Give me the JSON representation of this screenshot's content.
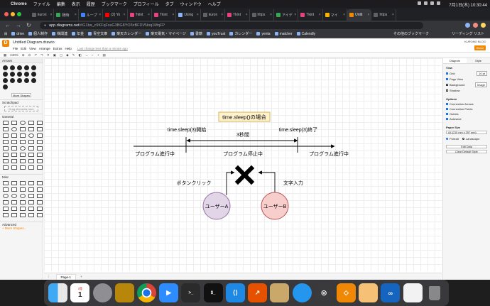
{
  "menubar": {
    "app": "Chrome",
    "items": [
      "ファイル",
      "編集",
      "表示",
      "履歴",
      "ブックマーク",
      "プロフィール",
      "タブ",
      "ウィンドウ",
      "ヘルプ"
    ],
    "clock": "7月1日(木) 10:30:44"
  },
  "tabs": [
    {
      "label": "kuron",
      "color": "#5f6368"
    },
    {
      "label": "随時",
      "color": "#34a853"
    },
    {
      "label": "ループ",
      "color": "#4285f4"
    },
    {
      "label": "(2) Yo",
      "color": "#ff0000"
    },
    {
      "label": "Tkint",
      "color": "#e8437a"
    },
    {
      "label": "Tkint",
      "color": "#e8437a"
    },
    {
      "label": "Using",
      "color": "#8ab4f8"
    },
    {
      "label": "kuron",
      "color": "#5f6368"
    },
    {
      "label": "Tkint",
      "color": "#e8437a"
    },
    {
      "label": "https",
      "color": "#5f6368"
    },
    {
      "label": "アイデ",
      "color": "#34a853"
    },
    {
      "label": "Tkint",
      "color": "#e8437a"
    },
    {
      "label": "マイ",
      "color": "#f4b400"
    },
    {
      "label": "Untit",
      "color": "#f08705"
    },
    {
      "label": "https",
      "color": "#5f6368"
    }
  ],
  "address": {
    "host": "app.diagrams.net",
    "path": "/#G1ba_c9KFqFssG3BG8YO3xBFDVNoq1MqFP"
  },
  "bookmarks": [
    "drive",
    "個人制作",
    "株関連",
    "年金",
    "青空文庫",
    "楽天カレンダー",
    "楽天電気・マイページ",
    "書籍",
    "youTrust",
    "カレンダー",
    "yenta",
    "matcher",
    "Calendly"
  ],
  "bookmarks_right": [
    "その他のブックマーク",
    "リーディング リスト"
  ],
  "drawio": {
    "logo": "D",
    "title": "Untitled Diagram.drawio",
    "menus": [
      "File",
      "Edit",
      "View",
      "Arrange",
      "Extras",
      "Help"
    ],
    "unsaved": "Last change less than a minute ago",
    "user": "KURONO BLOG",
    "share": "Share",
    "zoom": "240%",
    "sidebar": {
      "search_section": "Arrows",
      "more_shapes": "More Shapes",
      "scratchpad": "Scratchpad",
      "drop_here": "Drag elements here",
      "general": "General",
      "misc": "Misc",
      "advanced": "Advanced",
      "more_shapes_link": "+ More Shapes..."
    },
    "page_tab": "Page-1",
    "format": {
      "tab_diagram": "Diagram",
      "tab_style": "Style",
      "view": "View",
      "grid": "Grid",
      "grid_size": "10 pt",
      "page_view": "Page View",
      "background": "Background",
      "image": "Image",
      "shadow": "Shadow",
      "options": "Options",
      "connection_arrows": "Connection Arrows",
      "connection_points": "Connection Points",
      "guides": "Guides",
      "autosave": "Autosave",
      "paper_size": "Paper Size",
      "paper_value": "A4 (210 mm x 297 mm)",
      "portrait": "Portrait",
      "landscape": "Landscape",
      "edit_data": "Edit Data",
      "clear_default": "Clear Default Style"
    }
  },
  "diagram": {
    "title": "time.sleep()の場合",
    "start_label": "time.sleep(3)開始",
    "end_label": "time.sleep(3)終了",
    "duration": "3秒間",
    "running_left": "プログラム進行中",
    "stopped": "プログラム停止中",
    "running_right": "プログラム進行中",
    "left_event": "ボタンクリック",
    "right_event": "文字入力",
    "user_a": "ユーザーA",
    "user_b": "ユーザーB",
    "user_a_color": "#e1d5e7",
    "user_a_stroke": "#9673a6",
    "user_b_color": "#f8cecc",
    "user_b_stroke": "#b85450",
    "title_fill": "#fff2cc",
    "title_stroke": "#d6b656"
  },
  "dock": {
    "calendar_month": "7月",
    "calendar_day": "1"
  }
}
